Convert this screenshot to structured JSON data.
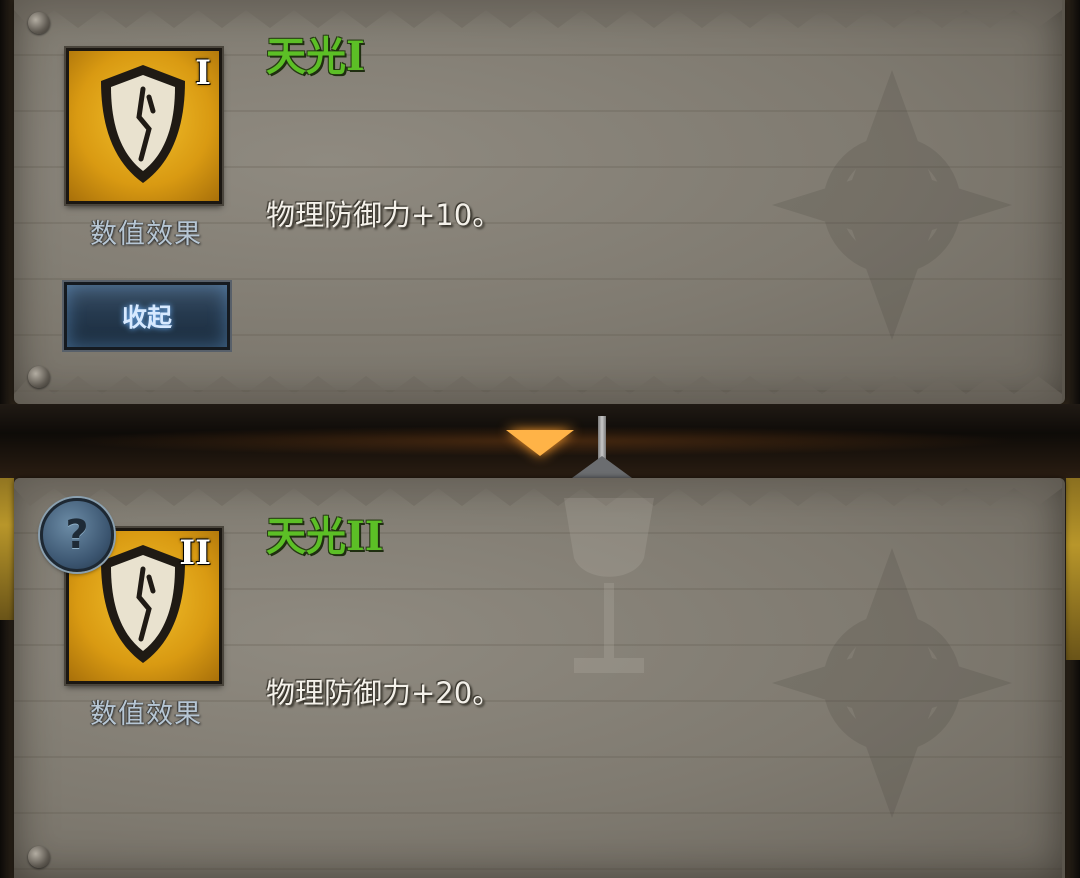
{
  "tiers": [
    {
      "name": "天光",
      "roman": "I",
      "icon": "shield-icon",
      "caption": "数值效果",
      "description": "物理防御力+10。",
      "state": "expanded"
    },
    {
      "name": "天光",
      "roman": "II",
      "icon": "shield-icon",
      "caption": "数值效果",
      "description": "物理防御力+20。",
      "state": "next"
    }
  ],
  "collapse_button": {
    "label": "收起"
  },
  "help_button": {
    "icon": "question-icon",
    "label": "?"
  },
  "colors": {
    "name_green": "#5cbf26",
    "icon_gold": "#d99a12",
    "caption_blue": "#b6c6d4",
    "arrow_orange": "#ffb347"
  }
}
